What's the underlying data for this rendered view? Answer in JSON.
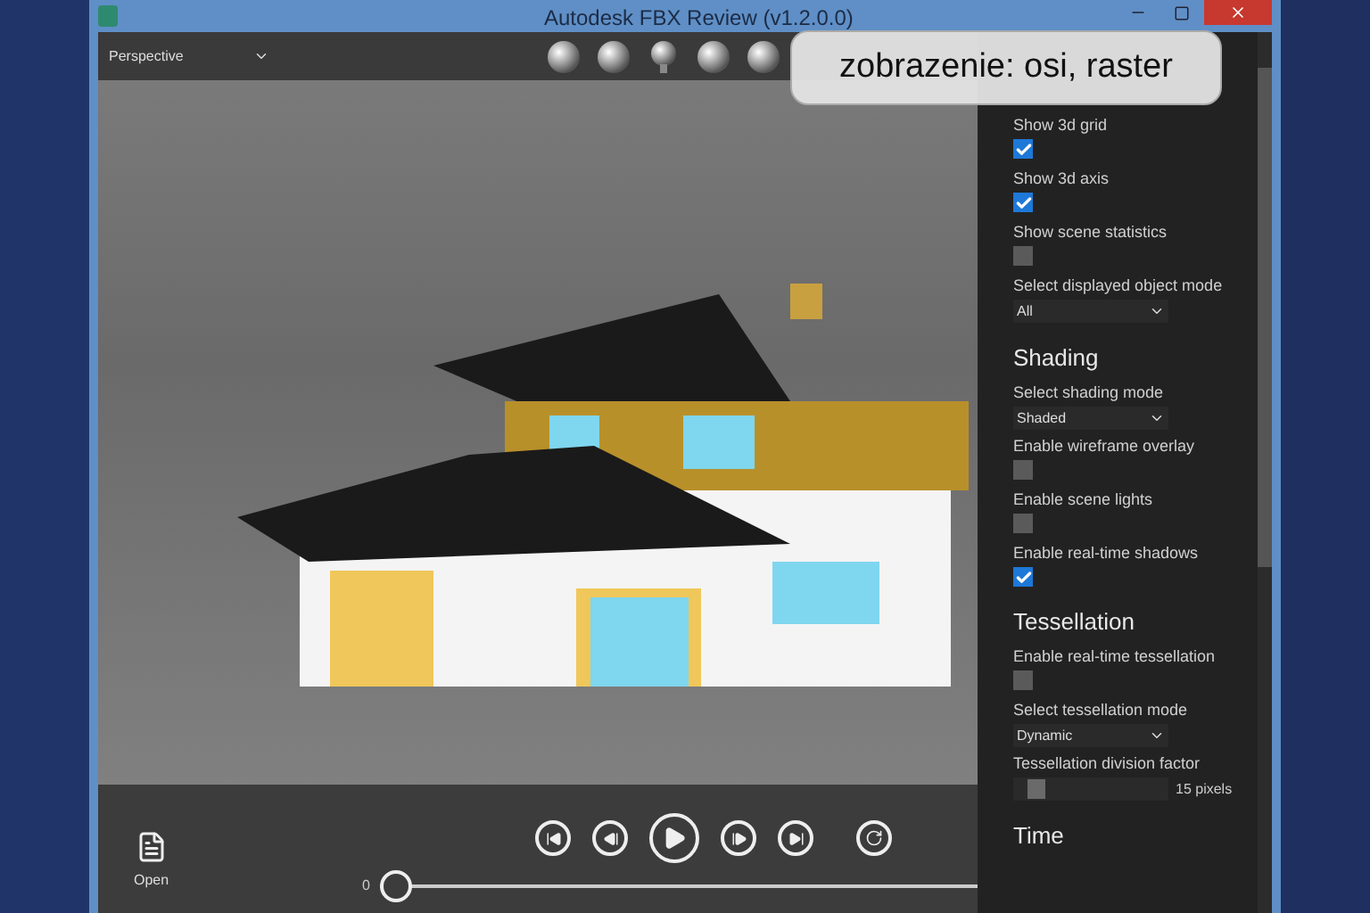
{
  "window": {
    "title": "Autodesk FBX Review (v1.2.0.0)"
  },
  "toolbar": {
    "camera": {
      "value": "Perspective"
    }
  },
  "caption": {
    "text": "zobrazenie: osi, raster"
  },
  "panel": {
    "sections": [
      {
        "items": [
          {
            "kind": "checkbox",
            "label": "Show 3d grid",
            "checked": true
          },
          {
            "kind": "checkbox",
            "label": "Show 3d axis",
            "checked": true
          },
          {
            "kind": "checkbox",
            "label": "Show scene statistics",
            "checked": false
          },
          {
            "kind": "select",
            "label": "Select displayed object mode",
            "value": "All"
          }
        ]
      },
      {
        "title": "Shading",
        "items": [
          {
            "kind": "select",
            "label": "Select shading mode",
            "value": "Shaded"
          },
          {
            "kind": "checkbox",
            "label": "Enable wireframe overlay",
            "checked": false
          },
          {
            "kind": "checkbox",
            "label": "Enable scene lights",
            "checked": false
          },
          {
            "kind": "checkbox",
            "label": "Enable real-time shadows",
            "checked": true
          }
        ]
      },
      {
        "title": "Tessellation",
        "items": [
          {
            "kind": "checkbox",
            "label": "Enable real-time tessellation",
            "checked": false
          },
          {
            "kind": "select",
            "label": "Select tessellation mode",
            "value": "Dynamic"
          },
          {
            "kind": "slider",
            "label": "Tessellation division factor",
            "level": 0.1,
            "reading": "15 pixels"
          }
        ]
      },
      {
        "title": "Time"
      }
    ]
  },
  "player": {
    "open_label": "Open",
    "time": "0",
    "timeline": {
      "level": 0
    }
  }
}
